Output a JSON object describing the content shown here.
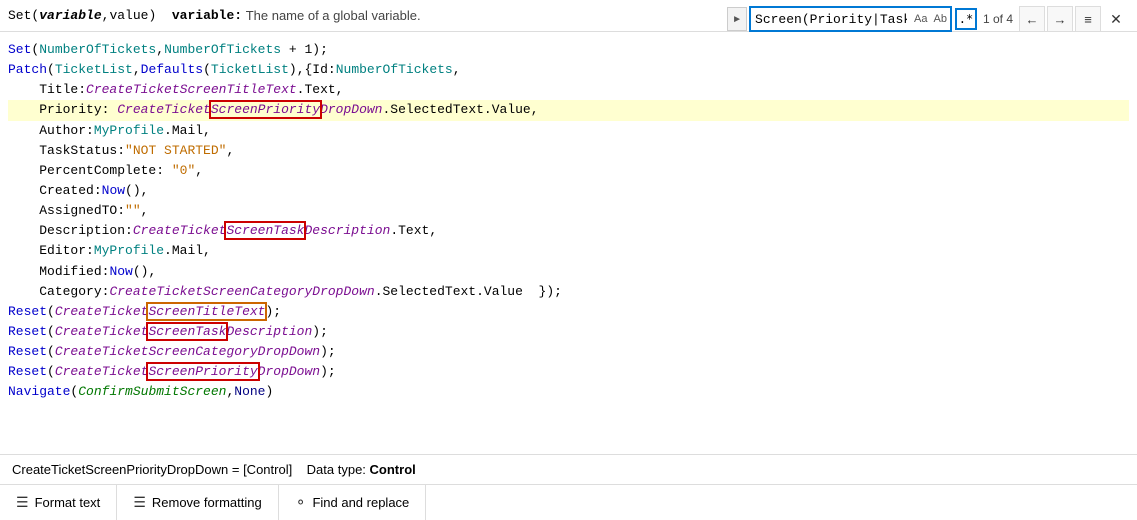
{
  "header": {
    "set_label": "Set(",
    "param1": "variable",
    "comma": ", ",
    "param2": "value",
    "close": ")",
    "separator": "variable:",
    "description": "The name of a global variable."
  },
  "search": {
    "value": "Screen(Priority|Task)",
    "aa_label": "Aa",
    "ab_label": "Ab",
    "regex_label": ".*",
    "count": "1 of 4",
    "prev_title": "Previous",
    "next_title": "Next",
    "list_title": "Show all",
    "close_title": "Close"
  },
  "code": {
    "lines": [
      "Set(NumberOfTickets,NumberOfTickets + 1);",
      "Patch(TicketList,Defaults(TicketList),{Id:NumberOfTickets,",
      "    Title:CreateTicketScreenTitleText.Text,",
      "    Priority: CreateTicketScreenPriorityDropDown.SelectedText.Value,",
      "    Author:MyProfile.Mail,",
      "    TaskStatus:\"NOT STARTED\",",
      "    PercentComplete: \"0\",",
      "    Created:Now(),",
      "    AssignedTO:\"\",",
      "    Description:CreateTicketScreenTaskDescription.Text,",
      "    Editor:MyProfile.Mail,",
      "    Modified:Now(),",
      "    Category:CreateTicketScreenCategoryDropDown.SelectedText.Value  });",
      "Reset(CreateTicketScreenTitleText);",
      "Reset(CreateTicketScreenTaskDescription);",
      "Reset(CreateTicketScreenCategoryDropDown);",
      "Reset(CreateTicketScreenPriorityDropDown);",
      "Navigate(ConfirmSubmitScreen,None)"
    ]
  },
  "status": {
    "text": "CreateTicketScreenPriorityDropDown = [Control]    Data type: ",
    "bold_text": "Control"
  },
  "footer": {
    "items": [
      {
        "icon": "≡",
        "label": "Format text"
      },
      {
        "icon": "≡",
        "label": "Remove formatting"
      },
      {
        "icon": "○",
        "label": "Find and replace"
      }
    ]
  }
}
